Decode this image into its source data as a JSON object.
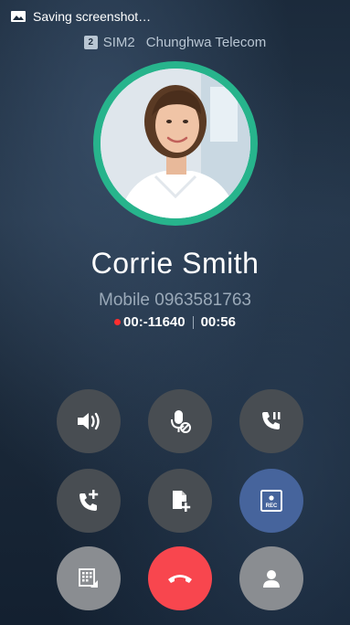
{
  "status_bar": {
    "notification_icon": "image-icon",
    "notification_text": "Saving screenshot…"
  },
  "sim_info": {
    "sim_slot": "2",
    "sim_name": "SIM2",
    "carrier": "Chunghwa Telecom"
  },
  "caller": {
    "name": "Corrie Smith",
    "number_line": "Mobile 0963581763",
    "recording_time": "00:-11640",
    "call_duration": "00:56"
  },
  "controls": {
    "row1": [
      "speaker-icon",
      "mute-mic-icon",
      "hold-call-icon"
    ],
    "row2": [
      "add-call-icon",
      "note-icon",
      "record-icon"
    ],
    "row3": [
      "dialpad-icon",
      "end-call-icon",
      "contact-icon"
    ]
  },
  "colors": {
    "avatar_ring": "#27b48c",
    "button_dark": "#484d52",
    "button_rec": "#46649c",
    "button_end": "#f8464e",
    "recording_dot": "#ff2e2e"
  }
}
